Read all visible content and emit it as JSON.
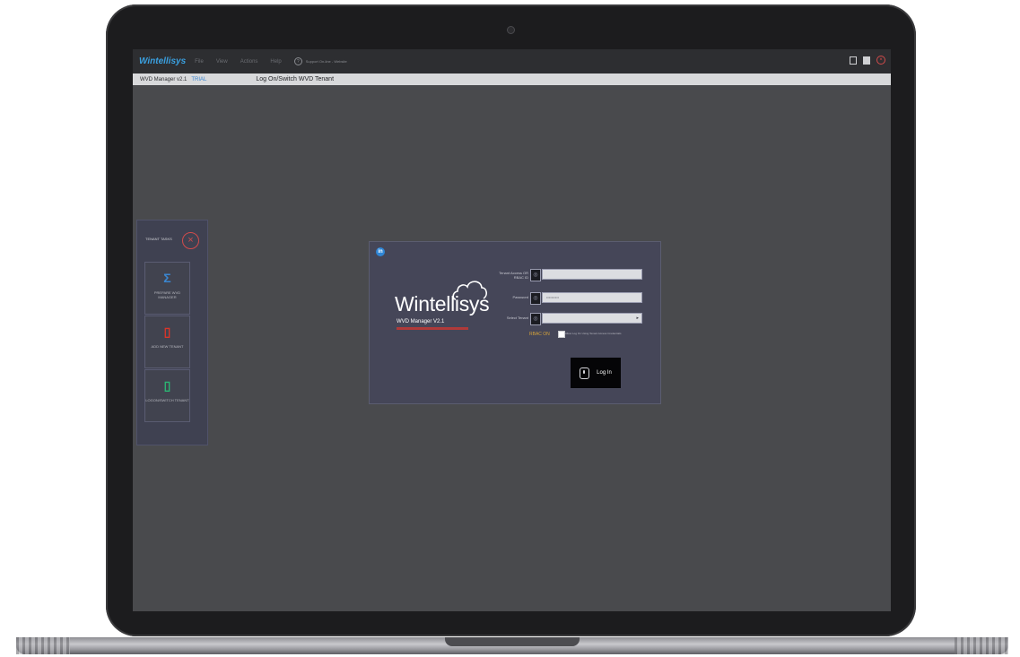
{
  "app": {
    "brand": "Wintellisys",
    "menu": [
      "File",
      "View",
      "Actions",
      "Help"
    ],
    "support": "Support On-line - Website",
    "version": "WVD Manager v2.1",
    "trial": "TRIAL",
    "page_title": "Log On/Switch WVD Tenant"
  },
  "side_panel": {
    "title": "TENANT TASKS",
    "tasks": [
      {
        "label": "PREPARE WVD MANAGER",
        "icon": "powershell-icon",
        "color": "#3a86d0"
      },
      {
        "label": "ADD NEW TENANT",
        "icon": "office-icon",
        "color": "#d9352a"
      },
      {
        "label": "LOGON/SWITCH TENANT",
        "icon": "office-icon",
        "color": "#2bb673"
      }
    ]
  },
  "login": {
    "logo_text": "Wintellisys",
    "product_version": "WVD Manager V2.1",
    "tenant_label": "Tenant Access OR RBAC ID",
    "tenant_value": "",
    "password_label": "Password",
    "password_value": "••••••••••",
    "select_label": "Select Tenant",
    "select_value": "",
    "rbac": "RBAC ON",
    "checkbox_label": "Allow Log On Using Tenant Access Credentials",
    "button": "Log In"
  }
}
